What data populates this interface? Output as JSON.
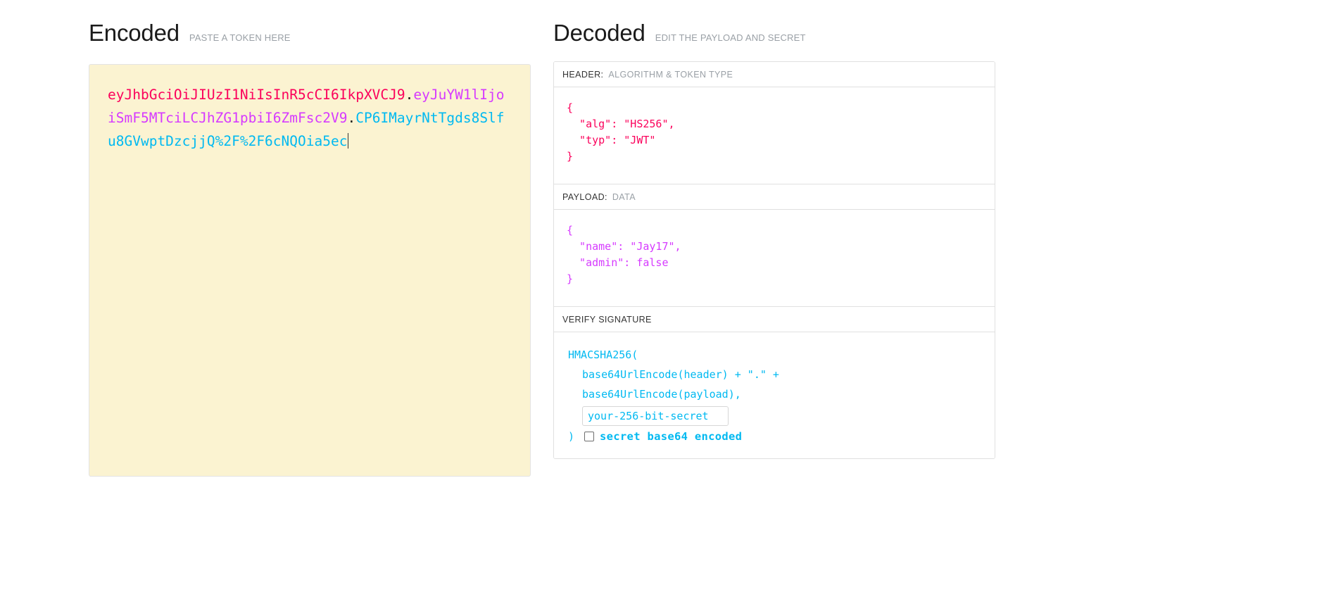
{
  "encoded": {
    "title": "Encoded",
    "subtitle": "PASTE A TOKEN HERE",
    "token": {
      "header_part": "eyJhbGciOiJIUzI1NiIsInR5cCI6IkpXVCJ9",
      "dot1": ".",
      "payload_part": "eyJuYW1lIjoiSmF5MTciLCJhZG1pbiI6ZmFsc2V9",
      "dot2": ".",
      "signature_part": "CP6IMayrNtTgds8Slfu8GVwptDzcjjQ%2F%2F6cNQOia5ec",
      "full": "eyJhbGciOiJIUzI1NiIsInR5cCI6IkpXVCJ9.eyJuYW1lIjoiSmF5MTciLCJhZG1pbiI6ZmFsc2V9.CP6IMayrNtTgds8Slfu8GVwptDzcjjQ%2F%2F6cNQOia5ec"
    },
    "colors": {
      "header": "#fb015b",
      "payload": "#d63aff",
      "signature": "#00b9f1",
      "background": "#fbf3d1"
    }
  },
  "decoded": {
    "title": "Decoded",
    "subtitle": "EDIT THE PAYLOAD AND SECRET",
    "header_section": {
      "label": "HEADER:",
      "sublabel": "ALGORITHM & TOKEN TYPE",
      "code": "{\n  \"alg\": \"HS256\",\n  \"typ\": \"JWT\"\n}"
    },
    "payload_section": {
      "label": "PAYLOAD:",
      "sublabel": "DATA",
      "code": "{\n  \"name\": \"Jay17\",\n  \"admin\": false\n}"
    },
    "signature_section": {
      "label": "VERIFY SIGNATURE",
      "sublabel": "",
      "line1": "HMACSHA256(",
      "line2": "base64UrlEncode(header) + \".\" +",
      "line3": "base64UrlEncode(payload),",
      "secret_value": "your-256-bit-secret",
      "secret_placeholder": "your-256-bit-secret",
      "closing_paren": ")",
      "base64_label": "secret base64 encoded",
      "base64_checked": false
    }
  }
}
